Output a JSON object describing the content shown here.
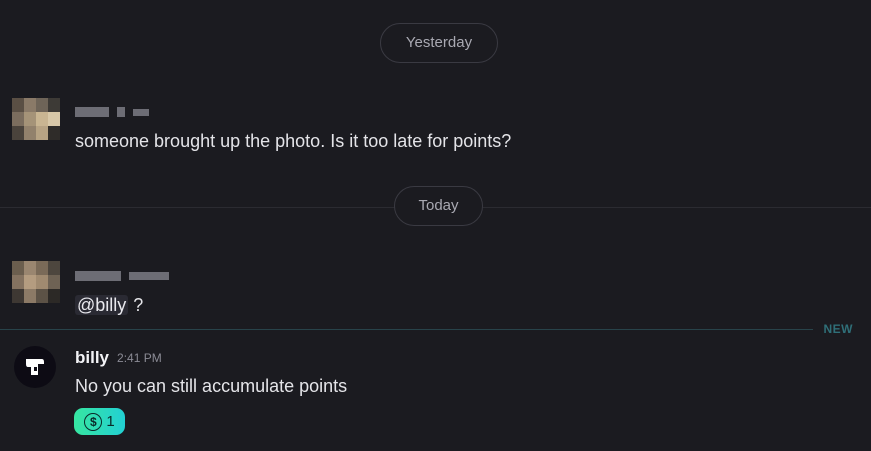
{
  "dividers": {
    "yesterday": "Yesterday",
    "today": "Today",
    "new": "NEW"
  },
  "messages": [
    {
      "author": "",
      "text": "someone brought up the photo. Is it too late for points?"
    },
    {
      "author": "",
      "mention": "@billy",
      "text_after_mention": " ?"
    },
    {
      "author": "billy",
      "time": "2:41 PM",
      "text": "No you can still accumulate points",
      "reaction": {
        "icon": "dollar-coin-icon",
        "symbol": "$",
        "count": "1"
      }
    }
  ],
  "colors": {
    "background": "#1b1b20",
    "new_accent": "#2f6f78",
    "reaction_start": "#37e6a1",
    "reaction_end": "#22d0d3"
  }
}
